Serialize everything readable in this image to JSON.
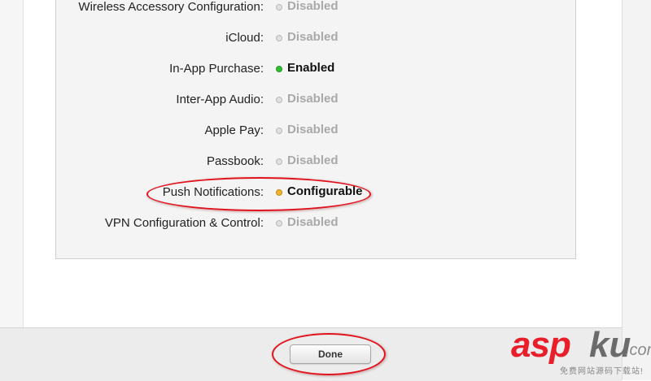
{
  "capabilities": [
    {
      "label": "Wireless Accessory Configuration:",
      "status": "Disabled",
      "state": "disabled"
    },
    {
      "label": "iCloud:",
      "status": "Disabled",
      "state": "disabled"
    },
    {
      "label": "In-App Purchase:",
      "status": "Enabled",
      "state": "enabled"
    },
    {
      "label": "Inter-App Audio:",
      "status": "Disabled",
      "state": "disabled"
    },
    {
      "label": "Apple Pay:",
      "status": "Disabled",
      "state": "disabled"
    },
    {
      "label": "Passbook:",
      "status": "Disabled",
      "state": "disabled"
    },
    {
      "label": "Push Notifications:",
      "status": "Configurable",
      "state": "configurable"
    },
    {
      "label": "VPN Configuration & Control:",
      "status": "Disabled",
      "state": "disabled"
    }
  ],
  "footer": {
    "done_label": "Done"
  },
  "colors": {
    "enabled": "#2fbf2f",
    "configurable": "#f0b330",
    "disabled": "#e0e0e0",
    "annotation": "#e0141e",
    "watermark_red": "#e81f2b"
  },
  "watermark": {
    "brand_a": "asp",
    "brand_b": "ku",
    "domain": ".com",
    "tagline": "免费网站源码下载站!"
  }
}
